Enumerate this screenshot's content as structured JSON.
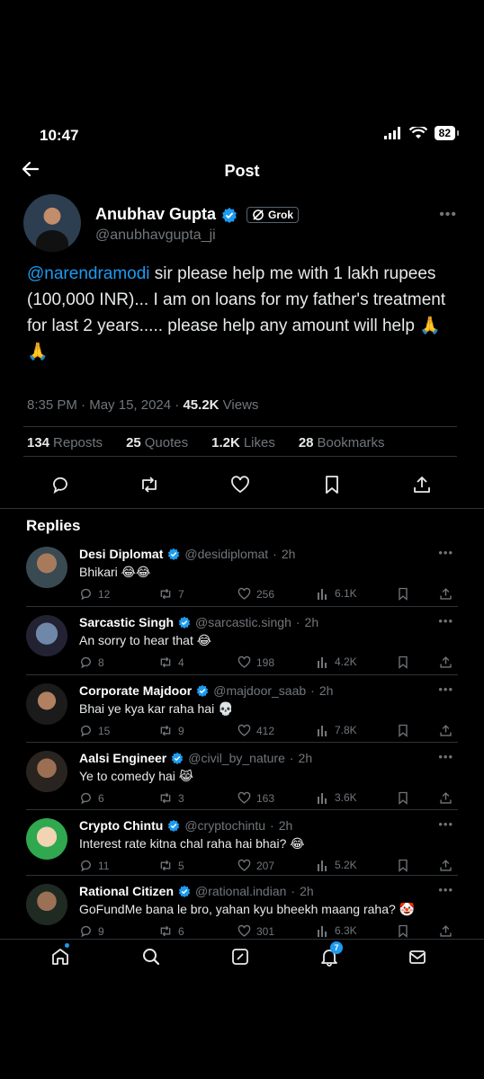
{
  "status_bar": {
    "time": "10:47",
    "battery": "82"
  },
  "header": {
    "title": "Post"
  },
  "post": {
    "author_name": "Anubhav Gupta",
    "grok_label": "Grok",
    "handle": "@anubhavgupta_ji",
    "mention": "@narendramodi",
    "text": " sir please help me with 1 lakh rupees (100,000 INR)... I am on loans for my father's treatment for last 2 years..... please help any amount will help 🙏🙏",
    "time": "8:35 PM",
    "date": "May 15, 2024",
    "views_count": "45.2K",
    "views_label": "Views",
    "stats": {
      "reposts_count": "134",
      "reposts_label": "Reposts",
      "quotes_count": "25",
      "quotes_label": "Quotes",
      "likes_count": "1.2K",
      "likes_label": "Likes",
      "bookmarks_count": "28",
      "bookmarks_label": "Bookmarks"
    }
  },
  "replies_title": "Replies",
  "replies": [
    {
      "name": "Desi Diplomat",
      "handle": "@desidiplomat",
      "time": "2h",
      "text": "Bhikari 😂😂",
      "replies": "12",
      "reposts": "7",
      "likes": "256",
      "views": "6.1K"
    },
    {
      "name": "Sarcastic Singh",
      "handle": "@sarcastic.singh",
      "time": "2h",
      "text": "An sorry to hear that 😂",
      "replies": "8",
      "reposts": "4",
      "likes": "198",
      "views": "4.2K"
    },
    {
      "name": "Corporate Majdoor",
      "handle": "@majdoor_saab",
      "time": "2h",
      "text": "Bhai ye kya kar raha hai 💀",
      "replies": "15",
      "reposts": "9",
      "likes": "412",
      "views": "7.8K"
    },
    {
      "name": "Aalsi Engineer",
      "handle": "@civil_by_nature",
      "time": "2h",
      "text": "Ye to comedy hai 😹",
      "replies": "6",
      "reposts": "3",
      "likes": "163",
      "views": "3.6K"
    },
    {
      "name": "Crypto Chintu",
      "handle": "@cryptochintu",
      "time": "2h",
      "text": "Interest rate kitna chal raha hai bhai? 😂",
      "replies": "11",
      "reposts": "5",
      "likes": "207",
      "views": "5.2K"
    },
    {
      "name": "Rational Citizen",
      "handle": "@rational.indian",
      "time": "2h",
      "text": "GoFundMe bana le bro, yahan kyu bheekh maang raha? 🤡",
      "replies": "9",
      "reposts": "6",
      "likes": "301",
      "views": "6.3K"
    }
  ],
  "nav": {
    "notifications_badge": "7"
  },
  "colors": {
    "accent": "#1d9bf0",
    "background": "#000000",
    "muted": "#71767b"
  }
}
